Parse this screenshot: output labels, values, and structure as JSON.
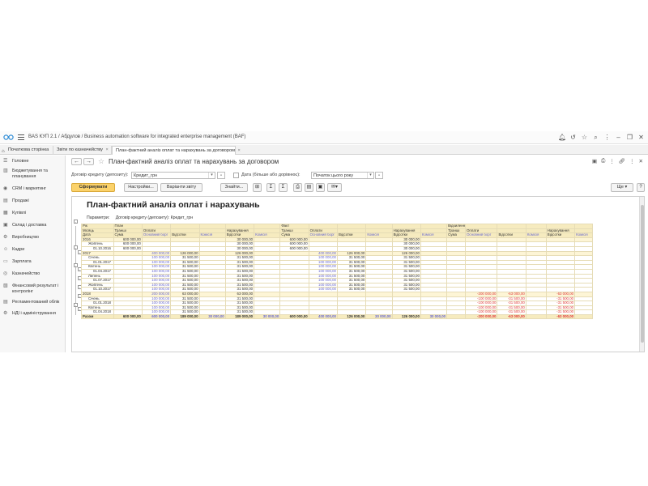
{
  "titlebar": {
    "app_title": "BAS КУП 2.1 / Абдулов / Business automation software for integrated enterprise management  (BAF)",
    "icons": [
      "bell-icon",
      "history-icon",
      "star-icon",
      "search-icon",
      "settings-icon",
      "minimize-icon",
      "restore-icon",
      "close-icon"
    ]
  },
  "tabs": [
    {
      "label": "Початкова сторінка"
    },
    {
      "label": "Звіти по казначейству",
      "close": "×"
    },
    {
      "label": "План-фактний аналіз оплат та нарахувань за договором",
      "close": "×"
    }
  ],
  "sidebar": {
    "items": [
      {
        "label": "Головне",
        "icon": "menu-icon"
      },
      {
        "label": "Бюджетування та планування",
        "icon": "chart-icon"
      },
      {
        "label": "CRM і маркетинг",
        "icon": "crm-icon"
      },
      {
        "label": "Продажі",
        "icon": "sales-icon"
      },
      {
        "label": "Купівлі",
        "icon": "cart-icon"
      },
      {
        "label": "Склад і доставка",
        "icon": "warehouse-icon"
      },
      {
        "label": "Виробництво",
        "icon": "factory-icon"
      },
      {
        "label": "Кадри",
        "icon": "people-icon"
      },
      {
        "label": "Зарплата",
        "icon": "salary-icon"
      },
      {
        "label": "Казначейство",
        "icon": "treasury-icon"
      },
      {
        "label": "Фінансовий результат і контролінг",
        "icon": "finance-icon"
      },
      {
        "label": "Регламентований облік",
        "icon": "ledger-icon"
      },
      {
        "label": "НДІ і адміністрування",
        "icon": "admin-icon"
      }
    ]
  },
  "form": {
    "title": "План-фактний аналіз оплат та нарахувань за договором",
    "back": "←",
    "forward": "→",
    "star": "☆",
    "header_icons": [
      "save-icon",
      "print-icon",
      "more-icon",
      "link-icon",
      "menu-icon",
      "close-icon"
    ],
    "params": {
      "contract_label": "Договір кредиту (депозиту):",
      "contract_value": "Кредит_грн",
      "date_label": "Дата (більше або дорівнює):",
      "date_value": "Початок цього року"
    },
    "toolbar": {
      "generate": "Сформувати",
      "settings": "Настройки...",
      "variant": "Варіанти звіту",
      "find": "Знайти...",
      "more": "Ще"
    }
  },
  "report": {
    "title": "План-фактний аналіз оплат і нарахувань",
    "params_label": "Параметри:",
    "params_value": "Договір кредиту (депозиту): Кредит_грн",
    "headers": {
      "row1": [
        "Рік",
        "План",
        "",
        "",
        "",
        "",
        "",
        "",
        "Факт",
        "",
        "",
        "",
        "",
        "",
        "",
        "Відхилення",
        "",
        "",
        "",
        "",
        "",
        ""
      ],
      "row2": [
        "Місяць",
        "Транші",
        "Оплати",
        "",
        "",
        "Нарахування",
        "",
        "",
        "Транші",
        "Оплати",
        "",
        "",
        "Нарахування",
        "",
        "",
        "Транші",
        "Оплати",
        "",
        "",
        "Нарахування",
        "",
        ""
      ],
      "row3": [
        "Дата",
        "Сума",
        "Основний борг",
        "Відсотки",
        "Комісія",
        "Відсотки",
        "Комісія",
        "",
        "Сума",
        "Основний борг",
        "Відсотки",
        "Комісія",
        "Відсотки",
        "Комісія",
        "",
        "Сума",
        "Основний борг",
        "Відсотки",
        "Комісія",
        "Відсотки",
        "Комісія",
        ""
      ]
    },
    "rows": [
      {
        "type": "year",
        "cells": [
          "2016",
          "600 000,00",
          "",
          "",
          "",
          "30 000,00",
          "",
          "",
          "600 000,00",
          "",
          "",
          "",
          "30 000,00",
          "",
          "",
          "",
          "",
          "",
          "",
          "",
          "",
          ""
        ]
      },
      {
        "type": "month",
        "cells": [
          "Жовтень",
          "600 000,00",
          "",
          "",
          "",
          "30 000,00",
          "",
          "",
          "600 000,00",
          "",
          "",
          "",
          "30 000,00",
          "",
          "",
          "",
          "",
          "",
          "",
          "",
          "",
          ""
        ]
      },
      {
        "type": "date",
        "cells": [
          "01.10.2016",
          "600 000,00",
          "",
          "",
          "",
          "30 000,00",
          "",
          "",
          "600 000,00",
          "",
          "",
          "",
          "30 000,00",
          "",
          "",
          "",
          "",
          "",
          "",
          "",
          "",
          ""
        ]
      },
      {
        "type": "year",
        "cells": [
          "2017",
          "",
          "400 000,00",
          "126 000,00",
          "",
          "126 000,00",
          "",
          "",
          "",
          "400 000,00",
          "126 000,00",
          "",
          "126 000,00",
          "",
          "",
          "",
          "",
          "",
          "",
          "",
          "",
          ""
        ]
      },
      {
        "type": "month",
        "cells": [
          "Січень",
          "",
          "100 000,00",
          "31 500,00",
          "",
          "31 500,00",
          "",
          "",
          "",
          "100 000,00",
          "31 500,00",
          "",
          "31 500,00",
          "",
          "",
          "",
          "",
          "",
          "",
          "",
          "",
          ""
        ]
      },
      {
        "type": "date",
        "cells": [
          "01.01.2017",
          "",
          "100 000,00",
          "31 500,00",
          "",
          "31 500,00",
          "",
          "",
          "",
          "100 000,00",
          "31 500,00",
          "",
          "31 500,00",
          "",
          "",
          "",
          "",
          "",
          "",
          "",
          "",
          ""
        ]
      },
      {
        "type": "month",
        "cells": [
          "Квітень",
          "",
          "100 000,00",
          "31 500,00",
          "",
          "31 500,00",
          "",
          "",
          "",
          "100 000,00",
          "31 500,00",
          "",
          "31 500,00",
          "",
          "",
          "",
          "",
          "",
          "",
          "",
          "",
          ""
        ]
      },
      {
        "type": "date",
        "cells": [
          "01.04.2017",
          "",
          "100 000,00",
          "31 500,00",
          "",
          "31 500,00",
          "",
          "",
          "",
          "100 000,00",
          "31 500,00",
          "",
          "31 500,00",
          "",
          "",
          "",
          "",
          "",
          "",
          "",
          "",
          ""
        ]
      },
      {
        "type": "month",
        "cells": [
          "Липень",
          "",
          "100 000,00",
          "31 500,00",
          "",
          "31 500,00",
          "",
          "",
          "",
          "100 000,00",
          "31 500,00",
          "",
          "31 500,00",
          "",
          "",
          "",
          "",
          "",
          "",
          "",
          "",
          ""
        ]
      },
      {
        "type": "date",
        "cells": [
          "01.07.2017",
          "",
          "100 000,00",
          "31 500,00",
          "",
          "31 500,00",
          "",
          "",
          "",
          "100 000,00",
          "31 500,00",
          "",
          "31 500,00",
          "",
          "",
          "",
          "",
          "",
          "",
          "",
          "",
          ""
        ]
      },
      {
        "type": "month",
        "cells": [
          "Жовтень",
          "",
          "100 000,00",
          "31 500,00",
          "",
          "31 500,00",
          "",
          "",
          "",
          "100 000,00",
          "31 500,00",
          "",
          "31 500,00",
          "",
          "",
          "",
          "",
          "",
          "",
          "",
          "",
          ""
        ]
      },
      {
        "type": "date",
        "cells": [
          "01.10.2017",
          "",
          "100 000,00",
          "31 500,00",
          "",
          "31 500,00",
          "",
          "",
          "",
          "100 000,00",
          "31 500,00",
          "",
          "31 500,00",
          "",
          "",
          "",
          "",
          "",
          "",
          "",
          "",
          ""
        ]
      },
      {
        "type": "year",
        "cells": [
          "2018",
          "",
          "200 000,00",
          "63 000,00",
          "",
          "63 000,00",
          "",
          "",
          "",
          "",
          "",
          "",
          "",
          "",
          "",
          "",
          "-200 000,00",
          "-63 000,00",
          "",
          "-63 000,00",
          "",
          ""
        ]
      },
      {
        "type": "month",
        "cells": [
          "Січень",
          "",
          "100 000,00",
          "31 500,00",
          "",
          "31 500,00",
          "",
          "",
          "",
          "",
          "",
          "",
          "",
          "",
          "",
          "",
          "-100 000,00",
          "-31 500,00",
          "",
          "-31 500,00",
          "",
          ""
        ]
      },
      {
        "type": "date",
        "cells": [
          "01.01.2018",
          "",
          "100 000,00",
          "31 500,00",
          "",
          "31 500,00",
          "",
          "",
          "",
          "",
          "",
          "",
          "",
          "",
          "",
          "",
          "-100 000,00",
          "-31 500,00",
          "",
          "-31 500,00",
          "",
          ""
        ]
      },
      {
        "type": "month",
        "cells": [
          "Квітень",
          "",
          "100 000,00",
          "31 500,00",
          "",
          "31 500,00",
          "",
          "",
          "",
          "",
          "",
          "",
          "",
          "",
          "",
          "",
          "-100 000,00",
          "-31 500,00",
          "",
          "-31 500,00",
          "",
          ""
        ]
      },
      {
        "type": "date",
        "cells": [
          "01.04.2018",
          "",
          "100 000,00",
          "31 500,00",
          "",
          "31 500,00",
          "",
          "",
          "",
          "",
          "",
          "",
          "",
          "",
          "",
          "",
          "-100 000,00",
          "-31 500,00",
          "",
          "-31 500,00",
          "",
          ""
        ]
      },
      {
        "type": "total",
        "cells": [
          "Разом",
          "600 000,00",
          "600 000,00",
          "189 000,00",
          "30 000,00",
          "189 000,00",
          "30 000,00",
          "",
          "600 000,00",
          "400 000,00",
          "126 000,00",
          "30 000,00",
          "126 000,00",
          "30 000,00",
          "",
          "",
          "-200 000,00",
          "-63 000,00",
          "",
          "-63 000,00",
          "",
          ""
        ]
      }
    ]
  }
}
